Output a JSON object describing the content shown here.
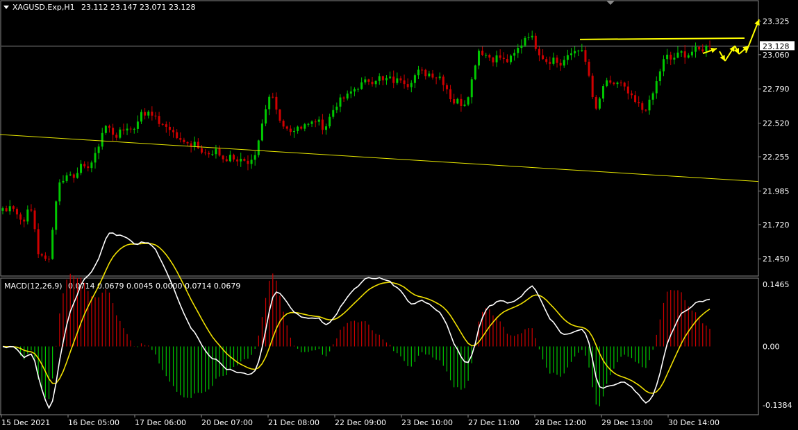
{
  "header": {
    "symbol": "XAGUSD.Exp,H1",
    "ohlc": "23.112 23.147 23.071 23.128"
  },
  "macd_header": {
    "label": "MACD(12,26,9)",
    "values": "0.0714 0.0679 0.0045 0.0000 0.0714 0.0679"
  },
  "colors": {
    "background": "#000000",
    "bull": "#00c800",
    "bear": "#d00000",
    "macd_line": "#ffffff",
    "signal_line": "#f0e000",
    "trendline": "#e8e800",
    "annotation": "#ffff00",
    "frame": "#8a8a8a",
    "price_line": "#8a8a8a"
  },
  "chart_data": [
    {
      "type": "candlestick",
      "symbol": "XAGUSD.Exp",
      "timeframe": "H1",
      "price_ticks": [
        "23.325",
        "23.060",
        "22.790",
        "22.520",
        "22.255",
        "21.985",
        "21.720",
        "21.450"
      ],
      "current_price": "23.128",
      "ylim": [
        21.32,
        23.48
      ],
      "x_ticks": [
        "15 Dec 2021",
        "16 Dec 05:00",
        "17 Dec 06:00",
        "20 Dec 07:00",
        "21 Dec 08:00",
        "22 Dec 09:00",
        "23 Dec 10:00",
        "27 Dec 11:00",
        "28 Dec 12:00",
        "29 Dec 13:00",
        "30 Dec 14:00"
      ],
      "close_path": [
        21.85,
        21.82,
        21.9,
        21.84,
        21.78,
        21.74,
        21.8,
        21.86,
        21.72,
        21.5,
        21.46,
        21.44,
        21.48,
        21.78,
        22.02,
        22.07,
        22.1,
        22.12,
        22.1,
        22.15,
        22.18,
        22.15,
        22.2,
        22.22,
        22.3,
        22.42,
        22.5,
        22.48,
        22.44,
        22.42,
        22.45,
        22.47,
        22.5,
        22.45,
        22.52,
        22.6,
        22.58,
        22.62,
        22.6,
        22.55,
        22.52,
        22.48,
        22.5,
        22.46,
        22.42,
        22.38,
        22.36,
        22.38,
        22.35,
        22.38,
        22.33,
        22.3,
        22.28,
        22.25,
        22.3,
        22.28,
        22.24,
        22.22,
        22.28,
        22.2,
        22.23,
        22.25,
        22.22,
        22.2,
        22.26,
        22.38,
        22.5,
        22.62,
        22.72,
        22.7,
        22.56,
        22.5,
        22.47,
        22.48,
        22.46,
        22.5,
        22.49,
        22.52,
        22.5,
        22.53,
        22.55,
        22.5,
        22.48,
        22.55,
        22.62,
        22.67,
        22.7,
        22.72,
        22.74,
        22.78,
        22.8,
        22.82,
        22.84,
        22.86,
        22.85,
        22.87,
        22.88,
        22.84,
        22.88,
        22.86,
        22.84,
        22.88,
        22.86,
        22.82,
        22.86,
        22.9,
        22.93,
        22.92,
        22.9,
        22.92,
        22.88,
        22.9,
        22.85,
        22.8,
        22.72,
        22.68,
        22.7,
        22.66,
        22.7,
        22.8,
        22.95,
        23.1,
        23.08,
        23.06,
        23.04,
        23.02,
        23.05,
        23.03,
        23.0,
        23.02,
        23.05,
        23.1,
        23.14,
        23.2,
        23.22,
        23.18,
        23.1,
        23.06,
        23.02,
        23.0,
        23.04,
        23.0,
        22.98,
        23.02,
        23.04,
        23.08,
        23.1,
        23.12,
        23.02,
        22.95,
        22.72,
        22.62,
        22.72,
        22.8,
        22.85,
        22.84,
        22.82,
        22.84,
        22.8,
        22.76,
        22.72,
        22.68,
        22.66,
        22.62,
        22.65,
        22.7,
        22.8,
        22.9,
        23.0,
        23.05,
        23.02,
        23.04,
        23.06,
        23.08,
        23.05,
        23.07,
        23.1,
        23.09,
        23.1,
        23.12,
        23.128
      ],
      "trendlines": [
        {
          "from": {
            "x": "15 Dec 2021",
            "y": 22.43
          },
          "to": {
            "x": "30 Dec 14:00",
            "y": 22.06
          }
        },
        {
          "from": {
            "x": "28 Dec 12:00",
            "y": 23.18
          },
          "to": {
            "x": "30 Dec 14:00",
            "y": 23.19
          }
        }
      ]
    },
    {
      "type": "macd",
      "title": "MACD(12,26,9)",
      "params": [
        12,
        26,
        9
      ],
      "ticks": [
        "0.1465",
        "0.00",
        "-0.1384"
      ],
      "ylim": [
        -0.16,
        0.16
      ],
      "histogram_color_rule": "red above zero, green below zero"
    }
  ]
}
